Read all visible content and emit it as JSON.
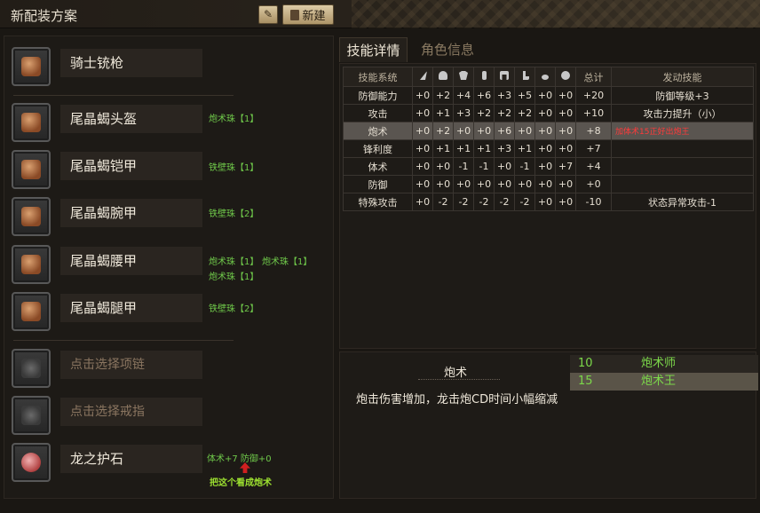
{
  "window": {
    "title": "新配装方案",
    "new_label": "新建"
  },
  "left": {
    "weapon": {
      "name": "骑士铳枪"
    },
    "armor": [
      {
        "name": "尾晶蝎头盔",
        "jewels": [
          "炮术珠【1】"
        ]
      },
      {
        "name": "尾晶蝎铠甲",
        "jewels": [
          "铁壁珠【1】"
        ]
      },
      {
        "name": "尾晶蝎腕甲",
        "jewels": [
          "铁壁珠【2】"
        ]
      },
      {
        "name": "尾晶蝎腰甲",
        "jewels": [
          "炮术珠【1】",
          "炮术珠【1】",
          "炮术珠【1】"
        ]
      },
      {
        "name": "尾晶蝎腿甲",
        "jewels": [
          "铁壁珠【2】"
        ]
      }
    ],
    "accessories": [
      {
        "name": "点击选择项链"
      },
      {
        "name": "点击选择戒指"
      }
    ],
    "charm": {
      "name": "龙之护石",
      "skills": "体术+7  防御+0"
    },
    "annotation": "把这个看成炮术"
  },
  "right": {
    "tabs": [
      {
        "label": "技能详情",
        "active": true
      },
      {
        "label": "角色信息",
        "active": false
      }
    ],
    "table": {
      "col_headers": [
        "技能系统",
        "总计",
        "发动技能"
      ],
      "header_icons": [
        "weapon-icon",
        "helmet-icon",
        "chest-icon",
        "arm-icon",
        "waist-icon",
        "legs-icon",
        "necklace-icon",
        "ring-icon"
      ],
      "rows": [
        {
          "skill": "防御能力",
          "values": [
            "+0",
            "+2",
            "+4",
            "+6",
            "+3",
            "+5",
            "+0",
            "+0"
          ],
          "total": "+20",
          "activated": "防御等级+3"
        },
        {
          "skill": "攻击",
          "values": [
            "+0",
            "+1",
            "+3",
            "+2",
            "+2",
            "+2",
            "+0",
            "+0"
          ],
          "total": "+10",
          "activated": "攻击力提升（小）"
        },
        {
          "skill": "炮术",
          "values": [
            "+0",
            "+2",
            "+0",
            "+0",
            "+6",
            "+0",
            "+0",
            "+0"
          ],
          "total": "+8",
          "activated": "加体术15正好出炮王"
        },
        {
          "skill": "锋利度",
          "values": [
            "+0",
            "+1",
            "+1",
            "+1",
            "+3",
            "+1",
            "+0",
            "+0"
          ],
          "total": "+7",
          "activated": ""
        },
        {
          "skill": "体术",
          "values": [
            "+0",
            "+0",
            "-1",
            "-1",
            "+0",
            "-1",
            "+0",
            "+7"
          ],
          "total": "+4",
          "activated": ""
        },
        {
          "skill": "防御",
          "values": [
            "+0",
            "+0",
            "+0",
            "+0",
            "+0",
            "+0",
            "+0",
            "+0"
          ],
          "total": "+0",
          "activated": ""
        },
        {
          "skill": "特殊攻击",
          "values": [
            "+0",
            "-2",
            "-2",
            "-2",
            "-2",
            "-2",
            "+0",
            "+0"
          ],
          "total": "-10",
          "activated": "状态异常攻击-1"
        }
      ]
    },
    "detail": {
      "skill_name": "炮术",
      "description": "炮击伤害增加，龙击炮CD时间小幅缩减",
      "levels": [
        {
          "points": "10",
          "name": "炮术师"
        },
        {
          "points": "15",
          "name": "炮术王"
        }
      ]
    }
  }
}
